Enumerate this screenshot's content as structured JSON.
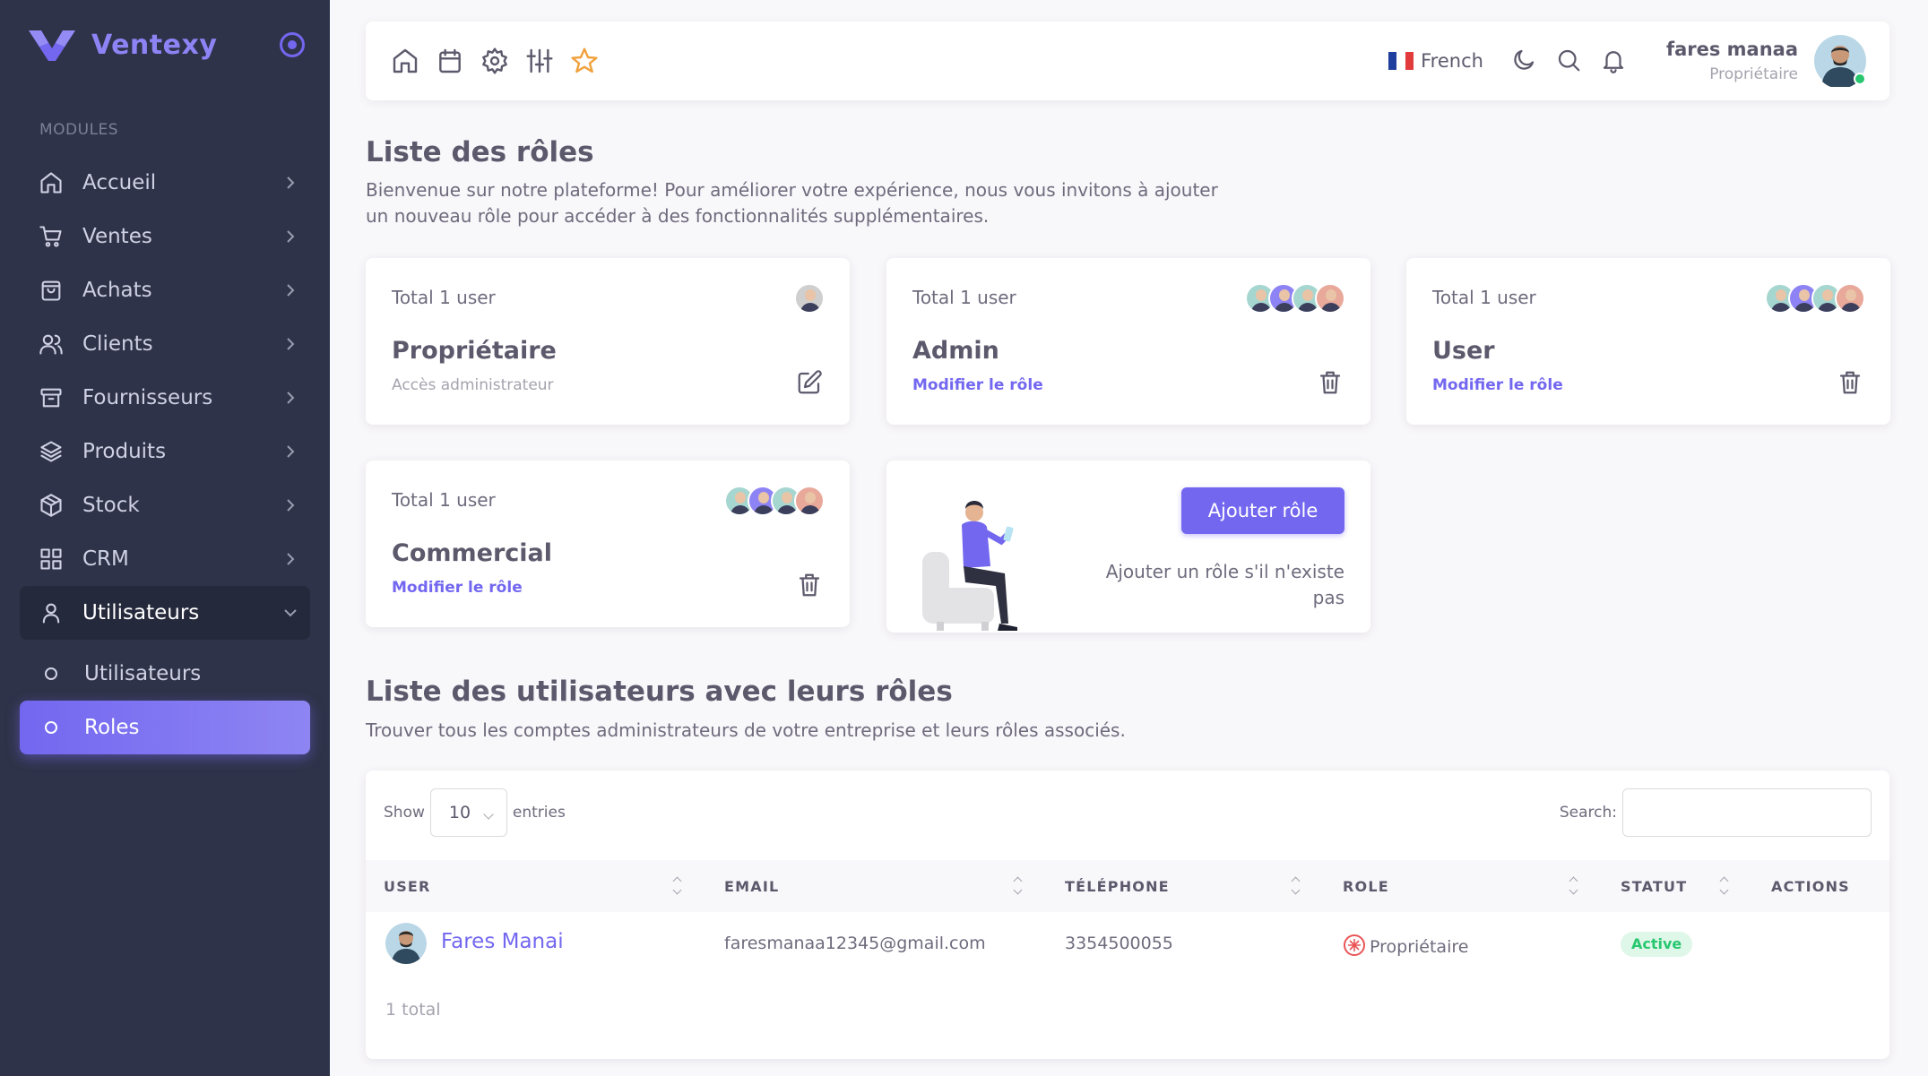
{
  "brand": {
    "name": "Ventexy",
    "color": "#7367f0"
  },
  "sidebar": {
    "section_header": "MODULES",
    "items": [
      {
        "label": "Accueil",
        "icon": "home-icon"
      },
      {
        "label": "Ventes",
        "icon": "cart-icon"
      },
      {
        "label": "Achats",
        "icon": "shopping-bag-icon"
      },
      {
        "label": "Clients",
        "icon": "users-icon"
      },
      {
        "label": "Fournisseurs",
        "icon": "archive-icon"
      },
      {
        "label": "Produits",
        "icon": "layers-icon"
      },
      {
        "label": "Stock",
        "icon": "box-icon"
      },
      {
        "label": "CRM",
        "icon": "grid-icon"
      },
      {
        "label": "Utilisateurs",
        "icon": "user-icon",
        "open": true
      }
    ],
    "subitems": [
      {
        "label": "Utilisateurs"
      },
      {
        "label": "Roles",
        "active": true
      }
    ]
  },
  "navbar": {
    "icons": [
      "home-icon",
      "calendar-icon",
      "gear-icon",
      "sliders-icon",
      "star-icon"
    ],
    "language": "French",
    "user_name": "fares manaa",
    "user_role": "Propriétaire"
  },
  "roles_section": {
    "title": "Liste des rôles",
    "description_line1": "Bienvenue sur notre plateforme! Pour améliorer votre expérience, nous vous invitons à ajouter",
    "description_line2": "un nouveau rôle pour accéder à des fonctionnalités supplémentaires."
  },
  "role_cards": [
    {
      "total": "Total 1 user",
      "name": "Propriétaire",
      "subtitle": "Accès administrateur",
      "action_icon": "edit-icon"
    },
    {
      "total": "Total 1 user",
      "name": "Admin",
      "link": "Modifier le rôle",
      "action_icon": "trash-icon"
    },
    {
      "total": "Total 1 user",
      "name": "User",
      "link": "Modifier le rôle",
      "action_icon": "trash-icon"
    },
    {
      "total": "Total 1 user",
      "name": "Commercial",
      "link": "Modifier le rôle",
      "action_icon": "trash-icon"
    }
  ],
  "add_role_card": {
    "button": "Ajouter rôle",
    "text_line1": "Ajouter un rôle s'il n'existe",
    "text_line2": "pas"
  },
  "users_section": {
    "title": "Liste des utilisateurs avec leurs rôles",
    "description": "Trouver tous les comptes administrateurs de votre entreprise et leurs rôles associés."
  },
  "table": {
    "show_label": "Show",
    "entries_value": "10",
    "entries_label": "entries",
    "search_label": "Search:",
    "search_value": "",
    "columns": [
      "USER",
      "EMAIL",
      "TÉLÉPHONE",
      "ROLE",
      "STATUT",
      "ACTIONS"
    ],
    "rows": [
      {
        "user": "Fares Manai",
        "email": "faresmanaa12345@gmail.com",
        "phone": "3354500055",
        "role": "Propriétaire",
        "status": "Active"
      }
    ],
    "total": "1 total"
  },
  "colors": {
    "primary": "#7367f0",
    "sidebar_bg": "#2f3349",
    "success": "#28c76f",
    "star": "#f0a13c"
  }
}
